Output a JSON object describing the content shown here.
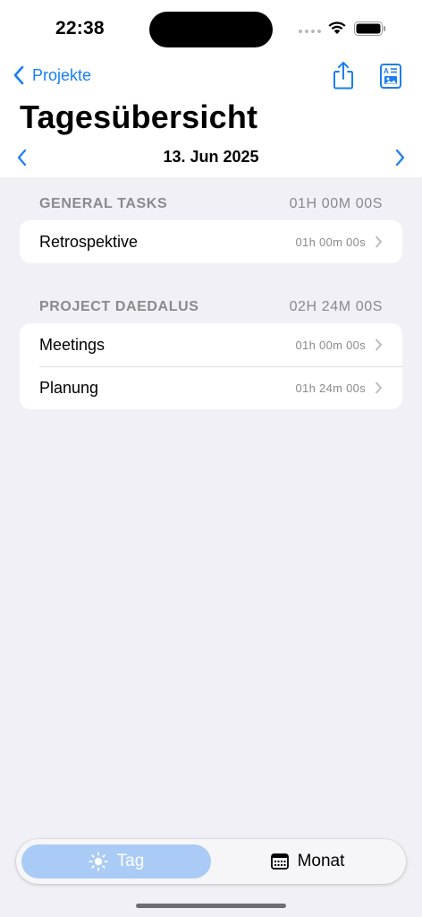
{
  "status_bar": {
    "time": "22:38"
  },
  "nav": {
    "back_label": "Projekte",
    "title": "Tagesübersicht",
    "date": "13. Jun 2025"
  },
  "sections": [
    {
      "name": "GENERAL TASKS",
      "total": "01H 00M 00S",
      "rows": [
        {
          "label": "Retrospektive",
          "duration": "01h 00m 00s"
        }
      ]
    },
    {
      "name": "PROJECT DAEDALUS",
      "total": "02H 24M 00S",
      "rows": [
        {
          "label": "Meetings",
          "duration": "01h 00m 00s"
        },
        {
          "label": "Planung",
          "duration": "01h 24m 00s"
        }
      ]
    }
  ],
  "segment": {
    "items": [
      {
        "label": "Tag",
        "icon": "sun-icon",
        "selected": true
      },
      {
        "label": "Monat",
        "icon": "calendar-icon",
        "selected": false
      }
    ]
  },
  "colors": {
    "accent": "#1a7ef2",
    "background": "#f1f0f6",
    "selected_segment": "#a9cbf5",
    "secondary_text": "#8a8a8e"
  }
}
